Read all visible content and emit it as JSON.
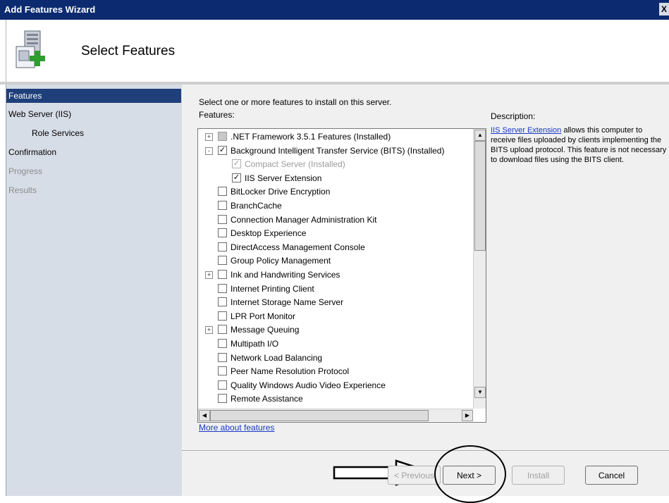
{
  "window": {
    "title": "Add Features Wizard",
    "close_label": "X"
  },
  "header": {
    "title": "Select Features"
  },
  "nav": {
    "items": [
      {
        "label": "Features",
        "state": "selected"
      },
      {
        "label": "Web Server (IIS)",
        "state": "normal"
      },
      {
        "label": "Role Services",
        "state": "normal"
      },
      {
        "label": "Confirmation",
        "state": "normal"
      },
      {
        "label": "Progress",
        "state": "disabled"
      },
      {
        "label": "Results",
        "state": "disabled"
      }
    ]
  },
  "main": {
    "instruction": "Select one or more features to install on this server.",
    "features_label": "Features:",
    "description_label": "Description:",
    "description_link": "IIS Server Extension",
    "description_text": " allows this computer to receive files uploaded by clients implementing the BITS upload protocol. This feature is not necessary to download files using the BITS client.",
    "more_link": "More about features"
  },
  "features": [
    {
      "label": ".NET Framework 3.5.1 Features  (Installed)",
      "expander": "+",
      "check": "partial",
      "indent": 0
    },
    {
      "label": "Background Intelligent Transfer Service (BITS)  (Installed)",
      "expander": "-",
      "check": "checked",
      "indent": 0
    },
    {
      "label": "Compact Server  (Installed)",
      "expander": "",
      "check": "checked-dim",
      "indent": 1
    },
    {
      "label": "IIS Server Extension",
      "expander": "",
      "check": "checked",
      "indent": 1
    },
    {
      "label": "BitLocker Drive Encryption",
      "expander": "",
      "check": "unchecked",
      "indent": 0
    },
    {
      "label": "BranchCache",
      "expander": "",
      "check": "unchecked",
      "indent": 0
    },
    {
      "label": "Connection Manager Administration Kit",
      "expander": "",
      "check": "unchecked",
      "indent": 0
    },
    {
      "label": "Desktop Experience",
      "expander": "",
      "check": "unchecked",
      "indent": 0
    },
    {
      "label": "DirectAccess Management Console",
      "expander": "",
      "check": "unchecked",
      "indent": 0
    },
    {
      "label": "Group Policy Management",
      "expander": "",
      "check": "unchecked",
      "indent": 0
    },
    {
      "label": "Ink and Handwriting Services",
      "expander": "+",
      "check": "unchecked",
      "indent": 0
    },
    {
      "label": "Internet Printing Client",
      "expander": "",
      "check": "unchecked",
      "indent": 0
    },
    {
      "label": "Internet Storage Name Server",
      "expander": "",
      "check": "unchecked",
      "indent": 0
    },
    {
      "label": "LPR Port Monitor",
      "expander": "",
      "check": "unchecked",
      "indent": 0
    },
    {
      "label": "Message Queuing",
      "expander": "+",
      "check": "unchecked",
      "indent": 0
    },
    {
      "label": "Multipath I/O",
      "expander": "",
      "check": "unchecked",
      "indent": 0
    },
    {
      "label": "Network Load Balancing",
      "expander": "",
      "check": "unchecked",
      "indent": 0
    },
    {
      "label": "Peer Name Resolution Protocol",
      "expander": "",
      "check": "unchecked",
      "indent": 0
    },
    {
      "label": "Quality Windows Audio Video Experience",
      "expander": "",
      "check": "unchecked",
      "indent": 0
    },
    {
      "label": "Remote Assistance",
      "expander": "",
      "check": "unchecked",
      "indent": 0
    }
  ],
  "buttons": {
    "previous": "< Previous",
    "next": "Next >",
    "install": "Install",
    "cancel": "Cancel"
  },
  "icons": {
    "wizard_icon": "server-add-icon",
    "checkmark": "✓",
    "expand": "+",
    "collapse": "-"
  },
  "colors": {
    "titlebar": "#0b2a6f",
    "nav_selected": "#1e3f7a",
    "nav_background": "#d7dde7",
    "link": "#1a39c4"
  }
}
